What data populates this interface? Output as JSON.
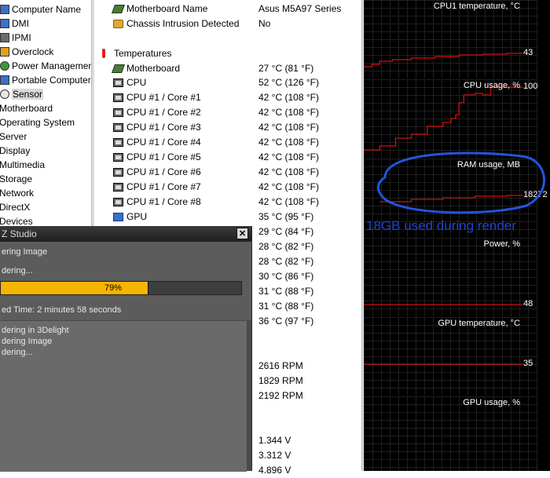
{
  "tree": {
    "items": [
      {
        "label": "Computer Name",
        "icon": "computer-icon",
        "color": "#3b6fc8"
      },
      {
        "label": "DMI",
        "icon": "dmi-icon",
        "color": "#3b6fc8"
      },
      {
        "label": "IPMI",
        "icon": "ipmi-icon",
        "color": "#6b6b6b"
      },
      {
        "label": "Overclock",
        "icon": "overclock-icon",
        "color": "#e0a020"
      },
      {
        "label": "Power Management",
        "icon": "power-icon",
        "color": "#3a9a3a"
      },
      {
        "label": "Portable Computers",
        "icon": "laptop-icon",
        "color": "#3b6fc8"
      },
      {
        "label": "Sensor",
        "icon": "sensor-icon",
        "color": "#d0d0d0"
      },
      {
        "label": "Motherboard",
        "icon": "",
        "color": ""
      },
      {
        "label": "Operating System",
        "icon": "",
        "color": ""
      },
      {
        "label": "Server",
        "icon": "",
        "color": ""
      },
      {
        "label": "Display",
        "icon": "",
        "color": ""
      },
      {
        "label": "Multimedia",
        "icon": "",
        "color": ""
      },
      {
        "label": "Storage",
        "icon": "",
        "color": ""
      },
      {
        "label": "Network",
        "icon": "",
        "color": ""
      },
      {
        "label": "DirectX",
        "icon": "",
        "color": ""
      },
      {
        "label": "Devices",
        "icon": "",
        "color": ""
      }
    ],
    "selected_index": 6
  },
  "list": {
    "rows": [
      {
        "name": "Motherboard Name",
        "value": "Asus M5A97 Series",
        "icon": "motherboard-icon"
      },
      {
        "name": "Chassis Intrusion Detected",
        "value": "No",
        "icon": "lock-icon"
      },
      {
        "name": "Temperatures",
        "value": "",
        "icon": "thermometer-icon",
        "group": true
      },
      {
        "name": "Motherboard",
        "value": "27 °C  (81 °F)",
        "icon": "motherboard-icon"
      },
      {
        "name": "CPU",
        "value": "52 °C  (126 °F)",
        "icon": "cpu-icon"
      },
      {
        "name": "CPU #1 / Core #1",
        "value": "42 °C  (108 °F)",
        "icon": "cpu-icon"
      },
      {
        "name": "CPU #1 / Core #2",
        "value": "42 °C  (108 °F)",
        "icon": "cpu-icon"
      },
      {
        "name": "CPU #1 / Core #3",
        "value": "42 °C  (108 °F)",
        "icon": "cpu-icon"
      },
      {
        "name": "CPU #1 / Core #4",
        "value": "42 °C  (108 °F)",
        "icon": "cpu-icon"
      },
      {
        "name": "CPU #1 / Core #5",
        "value": "42 °C  (108 °F)",
        "icon": "cpu-icon"
      },
      {
        "name": "CPU #1 / Core #6",
        "value": "42 °C  (108 °F)",
        "icon": "cpu-icon"
      },
      {
        "name": "CPU #1 / Core #7",
        "value": "42 °C  (108 °F)",
        "icon": "cpu-icon"
      },
      {
        "name": "CPU #1 / Core #8",
        "value": "42 °C  (108 °F)",
        "icon": "cpu-icon"
      },
      {
        "name": "GPU",
        "value": "35 °C  (95 °F)",
        "icon": "gpu-icon"
      },
      {
        "name": "",
        "value": "29 °C  (84 °F)",
        "icon": ""
      },
      {
        "name": "",
        "value": "28 °C  (82 °F)",
        "icon": ""
      },
      {
        "name": "",
        "value": "28 °C  (82 °F)",
        "icon": ""
      },
      {
        "name": "",
        "value": "30 °C  (86 °F)",
        "icon": ""
      },
      {
        "name": "",
        "value": "31 °C  (88 °F)",
        "icon": ""
      },
      {
        "name": "",
        "value": "31 °C  (88 °F)",
        "icon": ""
      },
      {
        "name": "",
        "value": "36 °C  (97 °F)",
        "icon": ""
      },
      {
        "name": "",
        "value": "",
        "icon": ""
      },
      {
        "name": "",
        "value": "2616 RPM",
        "icon": ""
      },
      {
        "name": "",
        "value": "1829 RPM",
        "icon": ""
      },
      {
        "name": "",
        "value": "2192 RPM",
        "icon": ""
      },
      {
        "name": "",
        "value": "",
        "icon": ""
      },
      {
        "name": "",
        "value": "",
        "icon": ""
      },
      {
        "name": "",
        "value": "1.344 V",
        "icon": ""
      },
      {
        "name": "",
        "value": "3.312 V",
        "icon": ""
      },
      {
        "name": "",
        "value": "4.896 V",
        "icon": ""
      }
    ]
  },
  "graphs": {
    "panels": [
      {
        "label": "CPU1 temperature, °C",
        "value": "43",
        "line_color": "#cc1111",
        "points": [
          [
            0,
            0.85
          ],
          [
            0.05,
            0.82
          ],
          [
            0.1,
            0.78
          ],
          [
            0.18,
            0.76
          ],
          [
            0.3,
            0.74
          ],
          [
            0.45,
            0.72
          ],
          [
            0.6,
            0.7
          ],
          [
            0.75,
            0.69
          ],
          [
            0.9,
            0.68
          ],
          [
            1,
            0.68
          ]
        ]
      },
      {
        "label": "CPU usage, %",
        "value": "100",
        "line_color": "#cc1111",
        "points": [
          [
            0,
            0.9
          ],
          [
            0.1,
            0.85
          ],
          [
            0.2,
            0.75
          ],
          [
            0.3,
            0.7
          ],
          [
            0.4,
            0.6
          ],
          [
            0.5,
            0.55
          ],
          [
            0.55,
            0.5
          ],
          [
            0.58,
            0.45
          ],
          [
            0.6,
            0.3
          ],
          [
            0.63,
            0.2
          ],
          [
            0.67,
            0.2
          ],
          [
            0.7,
            0.18
          ],
          [
            0.75,
            0.2
          ],
          [
            0.8,
            0.1
          ],
          [
            0.9,
            0.1
          ],
          [
            1,
            0.1
          ]
        ]
      },
      {
        "label": "RAM usage, MB",
        "value": "18272",
        "line_color": "#cc1111",
        "points": [
          [
            0.1,
            0.55
          ],
          [
            0.3,
            0.52
          ],
          [
            0.5,
            0.5
          ],
          [
            0.7,
            0.48
          ],
          [
            0.9,
            0.47
          ],
          [
            1,
            0.47
          ]
        ]
      },
      {
        "label": "Power, %",
        "value": "48",
        "line_color": "#cc1111",
        "points": [
          [
            0,
            0.85
          ],
          [
            1,
            0.85
          ]
        ]
      },
      {
        "label": "GPU temperature, °C",
        "value": "35",
        "line_color": "#cc1111",
        "points": [
          [
            0,
            0.6
          ],
          [
            1,
            0.6
          ]
        ]
      },
      {
        "label": "GPU usage, %",
        "value": "",
        "line_color": "#cc1111",
        "points": []
      }
    ]
  },
  "dialog": {
    "title": "Z Studio",
    "close_glyph": "✕",
    "line1": "ering Image",
    "line2": "dering...",
    "progress_text": "79%",
    "progress": 79,
    "elapsed_text": "ed Time:  2 minutes 58 seconds",
    "log": [
      "dering in 3Delight",
      "dering Image",
      "dering..."
    ]
  },
  "annotation": {
    "text": "18GB used during render",
    "color": "#2244cc"
  }
}
